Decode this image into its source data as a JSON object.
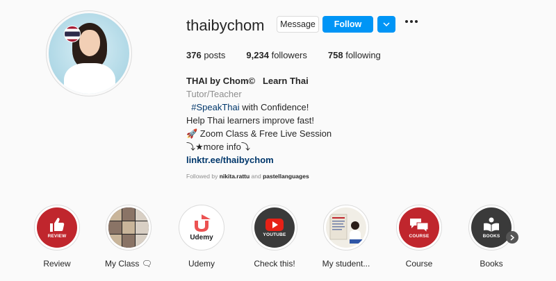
{
  "profile": {
    "username": "thaibychom",
    "message_label": "Message",
    "follow_label": "Follow",
    "dropdown_icon": "chevron-down-icon",
    "more_icon": "ellipsis-icon",
    "stats": {
      "posts_count": "376",
      "posts_label": "posts",
      "followers_count": "9,234",
      "followers_label": "followers",
      "following_count": "758",
      "following_label": "following"
    },
    "full_name": "THAI by Chom©   Learn Thai",
    "category": "Tutor/Teacher",
    "bio_line1_prefix": "  ",
    "bio_line1_tag": "#SpeakThai",
    "bio_line1_suffix": " with Confidence!",
    "bio_line2": "Help Thai learners improve fast!",
    "bio_line3": "🚀 Zoom Class & Free Live Session",
    "bio_line4": "⤵★more info⤵",
    "link": "linktr.ee/thaibychom",
    "followed_by_prefix": "Followed by ",
    "followed_by_user1": "nikita.rattu",
    "followed_by_and": " and ",
    "followed_by_user2": "pastellanguages"
  },
  "highlights": [
    {
      "label": "Review",
      "icon": "thumbs-up-icon",
      "badge_text": "REVIEW"
    },
    {
      "label": "My Class 🗨",
      "icon": "class-photo-grid"
    },
    {
      "label": "Udemy",
      "icon": "udemy-logo-icon",
      "badge_text": "Udemy"
    },
    {
      "label": "Check this!",
      "icon": "youtube-icon",
      "badge_text": "YOUTUBE"
    },
    {
      "label": "My student...",
      "icon": "student-photo"
    },
    {
      "label": "Course",
      "icon": "chat-bubbles-icon",
      "badge_text": "COURSE"
    },
    {
      "label": "Books",
      "icon": "book-reader-icon",
      "badge_text": "BOOKS"
    }
  ],
  "colors": {
    "follow_blue": "#0095f6",
    "highlight_red": "#c0262d",
    "link_blue": "#00376b"
  }
}
